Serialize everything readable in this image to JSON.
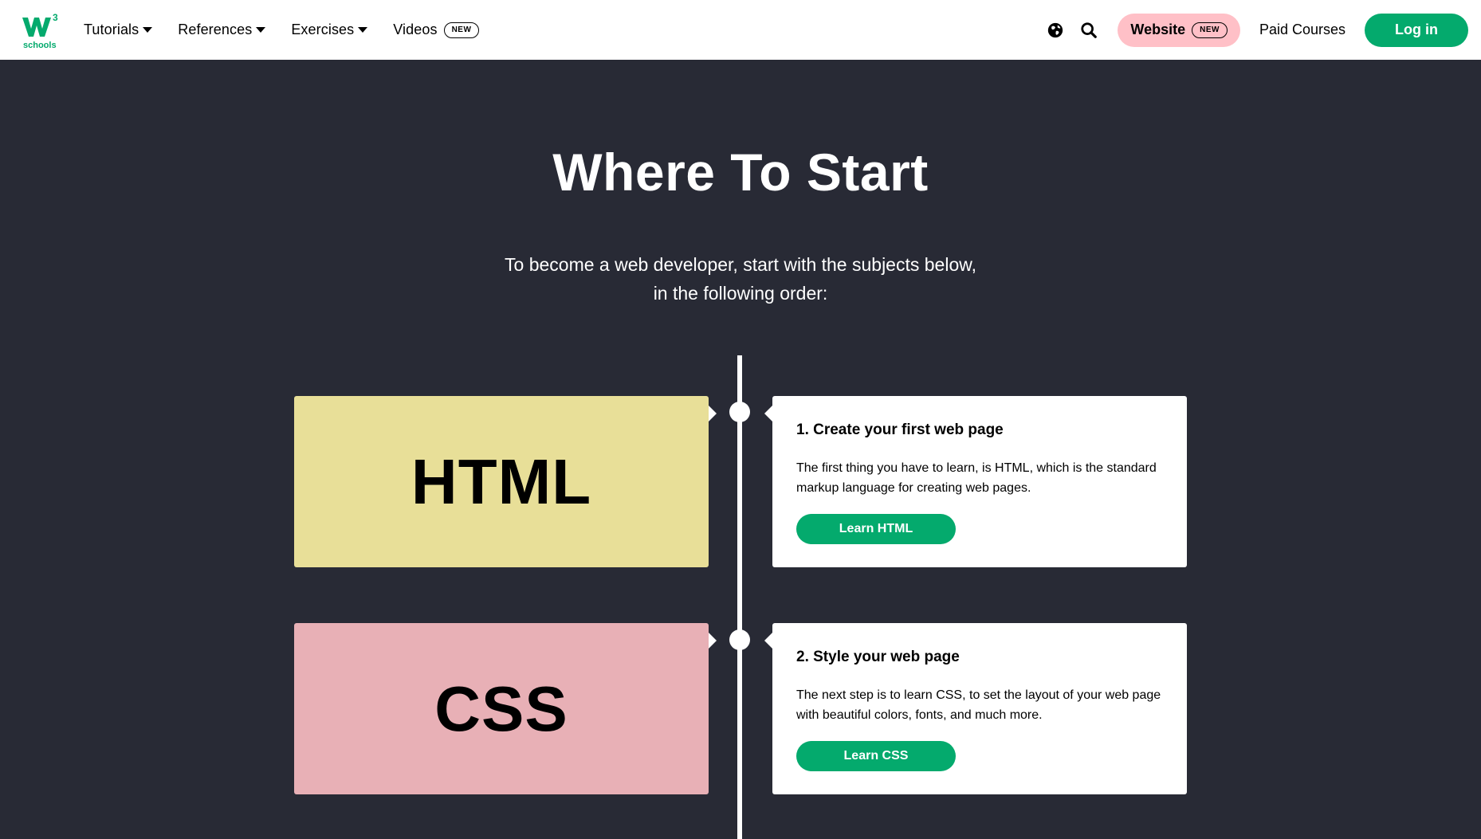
{
  "nav": {
    "logo_icon": "w3schools-logo-icon",
    "items": [
      {
        "label": "Tutorials",
        "has_caret": true
      },
      {
        "label": "References",
        "has_caret": true
      },
      {
        "label": "Exercises",
        "has_caret": true
      },
      {
        "label": "Videos",
        "badge": "NEW"
      }
    ],
    "globe_icon": "globe-icon",
    "search_icon": "search-icon",
    "website_label": "Website",
    "website_badge": "NEW",
    "paid_courses_label": "Paid Courses",
    "login_label": "Log in"
  },
  "hero": {
    "title": "Where To Start",
    "subtitle_line1": "To become a web developer, start with the subjects below,",
    "subtitle_line2": "in the following order:"
  },
  "steps": [
    {
      "subject": "HTML",
      "subject_color": "#e8df98",
      "title": "1. Create your first web page",
      "description": "The first thing you have to learn, is HTML, which is the standard markup language for creating web pages.",
      "button_label": "Learn HTML"
    },
    {
      "subject": "CSS",
      "subject_color": "#e8b0b6",
      "title": "2. Style your web page",
      "description": "The next step is to learn CSS, to set the layout of your web page with beautiful colors, fonts, and much more.",
      "button_label": "Learn CSS"
    }
  ],
  "colors": {
    "brand_green": "#04aa6d",
    "dark_bg": "#282a35",
    "website_pill": "#ffc0c7"
  }
}
